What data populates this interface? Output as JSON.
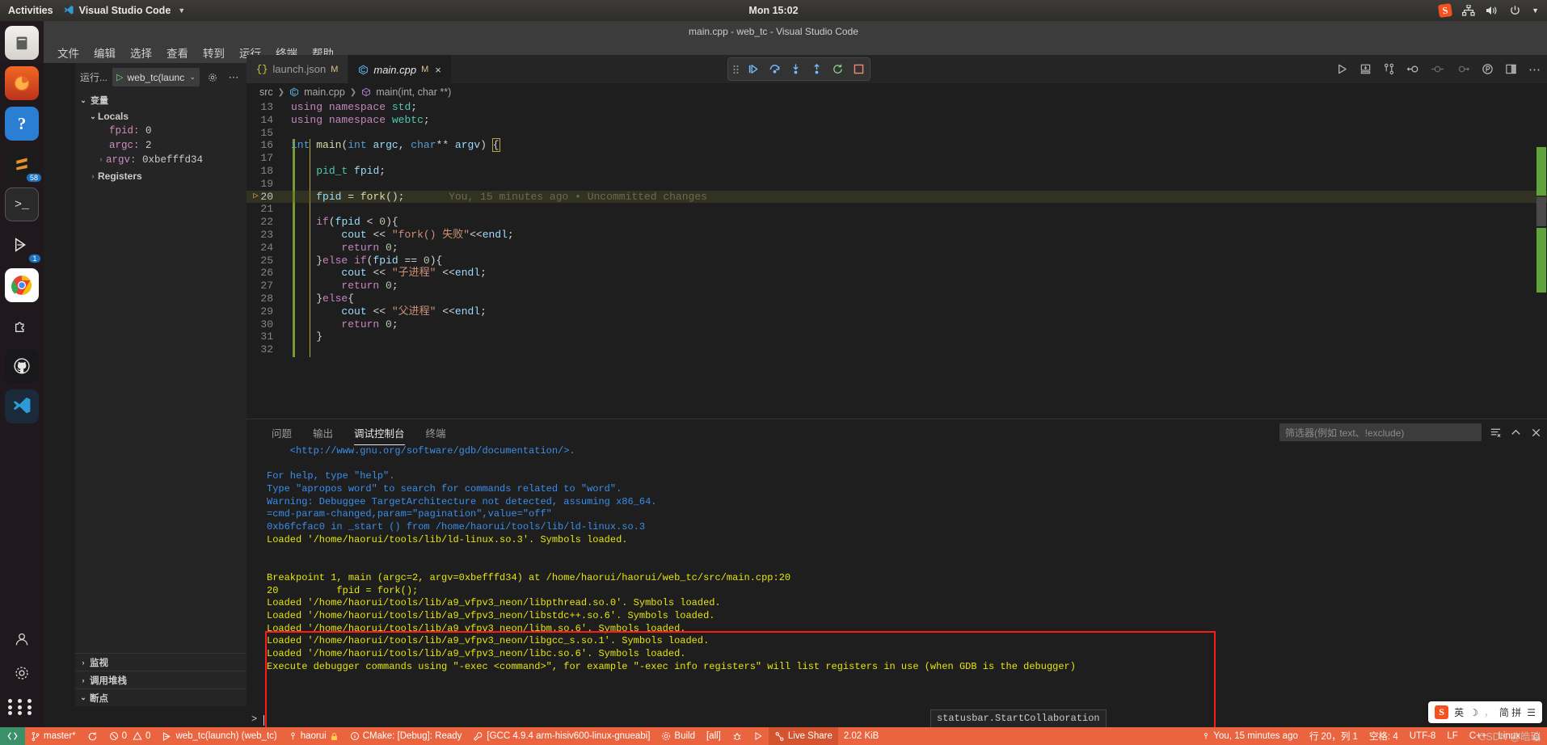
{
  "gnome": {
    "activities": "Activities",
    "app_menu": "Visual Studio Code",
    "clock": "Mon 15:02",
    "tray_icons": [
      "sogou-icon",
      "network-icon",
      "volume-icon",
      "power-icon",
      "chevron-down-icon"
    ]
  },
  "window": {
    "title": "main.cpp - web_tc - Visual Studio Code"
  },
  "menubar": [
    "文件",
    "编辑",
    "选择",
    "查看",
    "转到",
    "运行",
    "终端",
    "帮助"
  ],
  "dock": {
    "items": [
      {
        "name": "files-icon",
        "label": "Files"
      },
      {
        "name": "firefox-icon",
        "label": "Firefox"
      },
      {
        "name": "help-icon",
        "label": "Help"
      },
      {
        "name": "sublime-icon",
        "label": "Sublime Text",
        "badge": "58"
      },
      {
        "name": "terminal-icon",
        "label": "Terminal"
      },
      {
        "name": "debug-icon",
        "label": "Debug",
        "badge": "1"
      },
      {
        "name": "chrome-icon",
        "label": "Google Chrome"
      },
      {
        "name": "extension-icon",
        "label": "Extensions"
      },
      {
        "name": "github-icon",
        "label": "GitHub"
      },
      {
        "name": "vscode-icon",
        "label": "Visual Studio Code"
      }
    ],
    "bottom": [
      {
        "name": "user-icon",
        "label": "User"
      },
      {
        "name": "settings-icon",
        "label": "Settings"
      },
      {
        "name": "show-apps-icon",
        "label": "Show Applications"
      }
    ]
  },
  "sidebar": {
    "run_label": "运行...",
    "launch_config": "web_tc(launch",
    "gear_icon": "gear-icon",
    "more_icon": "ellipsis-icon",
    "variables_section": "变量",
    "locals_label": "Locals",
    "locals": [
      {
        "name": "fpid:",
        "value": "0"
      },
      {
        "name": "argc:",
        "value": "2"
      },
      {
        "name": "argv:",
        "value": "0xbefffd34",
        "expandable": true
      }
    ],
    "registers_label": "Registers",
    "watch_label": "监视",
    "callstack_label": "调用堆栈",
    "breakpoints_label": "断点"
  },
  "tabs": [
    {
      "label": "launch.json",
      "modified": "M",
      "icon": "json-icon",
      "active": false
    },
    {
      "label": "main.cpp",
      "modified": "M",
      "icon": "cpp-icon",
      "active": true,
      "close": "×"
    }
  ],
  "debug_toolbar": {
    "buttons": [
      {
        "name": "grip-handle",
        "glyph": "⠿"
      },
      {
        "name": "continue-button",
        "glyph": "▷|"
      },
      {
        "name": "step-over-button",
        "glyph": "↷"
      },
      {
        "name": "step-into-button",
        "glyph": "↓"
      },
      {
        "name": "step-out-button",
        "glyph": "↑"
      },
      {
        "name": "restart-button",
        "glyph": "↺"
      },
      {
        "name": "stop-button",
        "glyph": "□"
      }
    ]
  },
  "editor_actions": [
    {
      "name": "run-button",
      "glyph": "▷"
    },
    {
      "name": "run-and-debug-button",
      "glyph": "⎘"
    },
    {
      "name": "source-control-button",
      "glyph": "⑂"
    },
    {
      "name": "watch-expression-button",
      "glyph": "⊷"
    },
    {
      "name": "breakpoint-button",
      "glyph": "⊸"
    },
    {
      "name": "conditional-breakpoint-button",
      "glyph": "⊶"
    },
    {
      "name": "logpoint-button",
      "glyph": "◍"
    },
    {
      "name": "split-editor-button",
      "glyph": "▯"
    },
    {
      "name": "more-actions-button",
      "glyph": "⋯"
    }
  ],
  "breadcrumbs": [
    {
      "label": "src",
      "icon": null
    },
    {
      "label": "main.cpp",
      "icon": "cpp-icon"
    },
    {
      "label": "main(int, char **)",
      "icon": "symbol-method-icon"
    }
  ],
  "code": {
    "first_line": 13,
    "current_line": 20,
    "blame": "You, 15 minutes ago • Uncommitted changes",
    "lines": [
      {
        "n": 13,
        "text": "using namespace std;"
      },
      {
        "n": 14,
        "text": "using namespace webtc;"
      },
      {
        "n": 15,
        "text": ""
      },
      {
        "n": 16,
        "text": "int main(int argc, char** argv) {"
      },
      {
        "n": 17,
        "text": ""
      },
      {
        "n": 18,
        "text": "    pid_t fpid;"
      },
      {
        "n": 19,
        "text": ""
      },
      {
        "n": 20,
        "text": "    fpid = fork();"
      },
      {
        "n": 21,
        "text": ""
      },
      {
        "n": 22,
        "text": "    if(fpid < 0){"
      },
      {
        "n": 23,
        "text": "        cout << \"fork() 失败\"<<endl;"
      },
      {
        "n": 24,
        "text": "        return 0;"
      },
      {
        "n": 25,
        "text": "    }else if(fpid == 0){"
      },
      {
        "n": 26,
        "text": "        cout << \"子进程\" <<endl;"
      },
      {
        "n": 27,
        "text": "        return 0;"
      },
      {
        "n": 28,
        "text": "    }else{"
      },
      {
        "n": 29,
        "text": "        cout << \"父进程\" <<endl;"
      },
      {
        "n": 30,
        "text": "        return 0;"
      },
      {
        "n": 31,
        "text": "    }"
      },
      {
        "n": 32,
        "text": ""
      }
    ]
  },
  "panel": {
    "tabs": [
      {
        "label": "问题",
        "active": false
      },
      {
        "label": "输出",
        "active": false
      },
      {
        "label": "调试控制台",
        "active": true
      },
      {
        "label": "终端",
        "active": false
      }
    ],
    "filter_placeholder": "筛选器(例如 text、!exclude)",
    "actions": [
      {
        "name": "clear-console-icon",
        "glyph": "☰"
      },
      {
        "name": "maximize-panel-icon",
        "glyph": "⌃"
      },
      {
        "name": "close-panel-icon",
        "glyph": "✕"
      }
    ],
    "console_lines": [
      {
        "text": "    <http://www.gnu.org/software/gdb/documentation/>.",
        "color": "blue"
      },
      {
        "text": "",
        "color": "blue"
      },
      {
        "text": "For help, type \"help\".",
        "color": "blue"
      },
      {
        "text": "Type \"apropos word\" to search for commands related to \"word\".",
        "color": "blue"
      },
      {
        "text": "Warning: Debuggee TargetArchitecture not detected, assuming x86_64.",
        "color": "blue"
      },
      {
        "text": "=cmd-param-changed,param=\"pagination\",value=\"off\"",
        "color": "blue"
      },
      {
        "text": "0xb6fcfac0 in _start () from /home/haorui/tools/lib/ld-linux.so.3",
        "color": "blue"
      },
      {
        "text": "Loaded '/home/haorui/tools/lib/ld-linux.so.3'. Symbols loaded.",
        "color": "yellow"
      },
      {
        "text": "",
        "color": "blue"
      },
      {
        "text": "",
        "color": "blue"
      },
      {
        "text": "Breakpoint 1, main (argc=2, argv=0xbefffd34) at /home/haorui/haorui/web_tc/src/main.cpp:20",
        "color": "yellow"
      },
      {
        "text": "20          fpid = fork();",
        "color": "yellow"
      },
      {
        "text": "Loaded '/home/haorui/tools/lib/a9_vfpv3_neon/libpthread.so.0'. Symbols loaded.",
        "color": "yellow"
      },
      {
        "text": "Loaded '/home/haorui/tools/lib/a9_vfpv3_neon/libstdc++.so.6'. Symbols loaded.",
        "color": "yellow"
      },
      {
        "text": "Loaded '/home/haorui/tools/lib/a9_vfpv3_neon/libm.so.6'. Symbols loaded.",
        "color": "yellow"
      },
      {
        "text": "Loaded '/home/haorui/tools/lib/a9_vfpv3_neon/libgcc_s.so.1'. Symbols loaded.",
        "color": "yellow"
      },
      {
        "text": "Loaded '/home/haorui/tools/lib/a9_vfpv3_neon/libc.so.6'. Symbols loaded.",
        "color": "yellow"
      },
      {
        "text": "Execute debugger commands using \"-exec <command>\", for example \"-exec info registers\" will list registers in use (when GDB is the debugger)",
        "color": "yellow"
      }
    ],
    "prompt": ">"
  },
  "tooltip": "statusbar.StartCollaboration",
  "ime": {
    "logo": "S",
    "mode": "英",
    "moon": "☽",
    "dot": "，",
    "simplified": "简 拼",
    "menu": "☰"
  },
  "watermark": "CSDN @皓瑞",
  "statusbar": {
    "left": [
      {
        "name": "remote-indicator",
        "label": "",
        "icon": "remote-icon"
      },
      {
        "name": "git-branch",
        "label": "master*",
        "icon": "branch-icon"
      },
      {
        "name": "sync-changes",
        "label": "",
        "icon": "sync-icon"
      },
      {
        "name": "problems",
        "label": "0  0",
        "errors": "0",
        "warnings": "0"
      },
      {
        "name": "debug-config",
        "label": "web_tc(launch) (web_tc)",
        "icon": "debug-icon"
      },
      {
        "name": "remote-user",
        "label": "haorui",
        "icon": "account-icon"
      },
      {
        "name": "cmake-status",
        "label": "CMake: [Debug]: Ready",
        "icon": "info-icon"
      },
      {
        "name": "cmake-kit",
        "label": "[GCC 4.9.4 arm-hisiv600-linux-gnueabi]",
        "icon": "tools-icon"
      },
      {
        "name": "cmake-build",
        "label": "Build",
        "icon": "gear-icon"
      },
      {
        "name": "cmake-target",
        "label": "[all]"
      },
      {
        "name": "cmake-debug",
        "label": "",
        "icon": "bug-icon"
      },
      {
        "name": "cmake-run",
        "label": "",
        "icon": "play-icon"
      },
      {
        "name": "live-share",
        "label": "Live Share",
        "icon": "liveshare-icon"
      },
      {
        "name": "file-size",
        "label": "2.02 KiB"
      }
    ],
    "right": [
      {
        "name": "git-blame",
        "label": "You, 15 minutes ago",
        "icon": "blame-icon"
      },
      {
        "name": "cursor-position",
        "label": "行 20，列 1"
      },
      {
        "name": "indentation",
        "label": "空格: 4"
      },
      {
        "name": "encoding",
        "label": "UTF-8"
      },
      {
        "name": "eol",
        "label": "LF"
      },
      {
        "name": "language-mode",
        "label": "C++"
      },
      {
        "name": "platform",
        "label": "Linux"
      },
      {
        "name": "notifications",
        "label": "",
        "icon": "bell-icon"
      }
    ]
  }
}
